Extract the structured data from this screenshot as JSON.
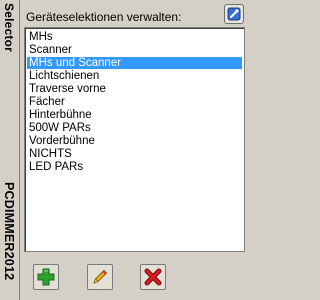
{
  "sidebar": {
    "top_label": "Selector",
    "bottom_label": "PCDIMMER2012"
  },
  "header": {
    "label": "Geräteselektionen verwalten:",
    "settings_icon": "settings-icon"
  },
  "list": {
    "items": [
      "MHs",
      "Scanner",
      "MHs und Scanner",
      "Lichtschienen",
      "Traverse vorne",
      "Fächer",
      "Hinterbühne",
      "500W PARs",
      "Vorderbühne",
      "NICHTS",
      "LED PARs"
    ],
    "selected_index": 2,
    "selection_color": "#3399ff"
  },
  "buttons": [
    {
      "name": "add-button",
      "icon": "plus-icon",
      "color": "#2ea02e"
    },
    {
      "name": "edit-button",
      "icon": "pencil-icon",
      "color": "#f2b21c"
    },
    {
      "name": "delete-button",
      "icon": "x-icon",
      "color": "#c81e1e"
    }
  ]
}
